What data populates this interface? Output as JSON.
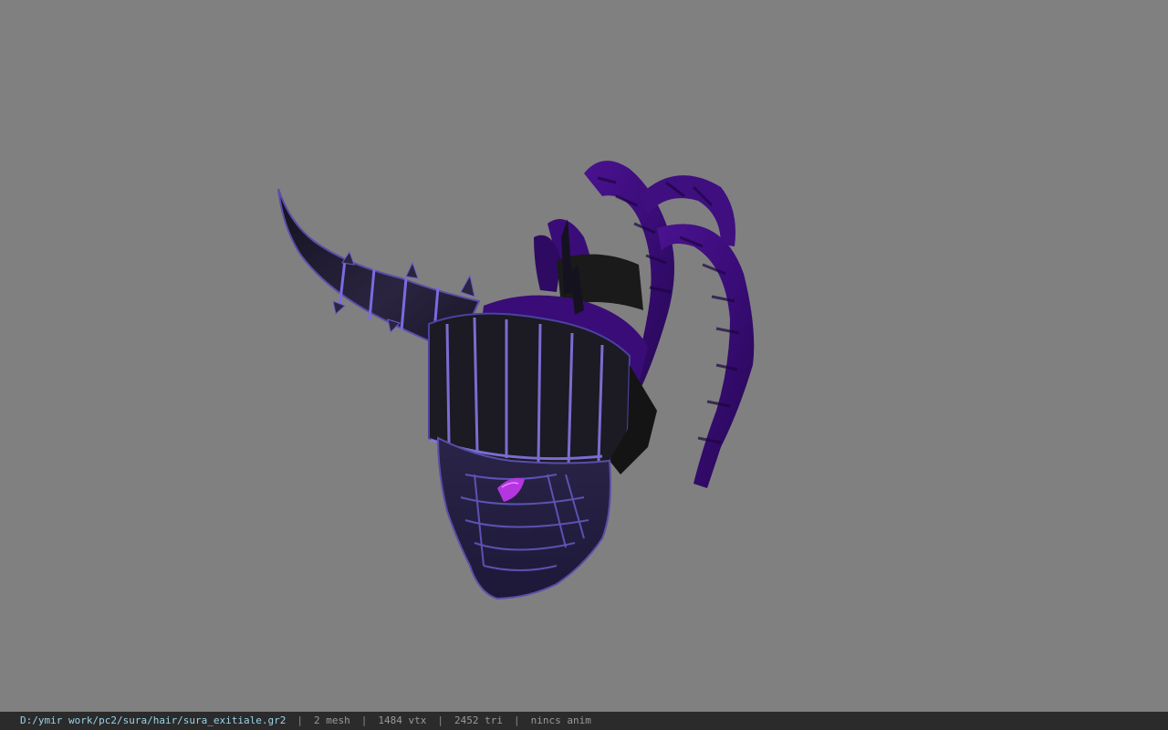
{
  "viewer": {
    "background_color": "#808080",
    "model_name": "sura_exitiale",
    "model_description_icon": "horned-helmet-model"
  },
  "status_bar": {
    "file_path": "D:/ymir work/pc2/sura/hair/sura_exitiale.gr2",
    "mesh_count": "2 mesh",
    "vertex_count": "1484 vtx",
    "triangle_count": "2452 tri",
    "anim_status": "nincs anim",
    "separator": "|",
    "path_color": "#9ad3e8",
    "text_color": "#9a9a9a",
    "bar_color": "#2b2b2b"
  }
}
